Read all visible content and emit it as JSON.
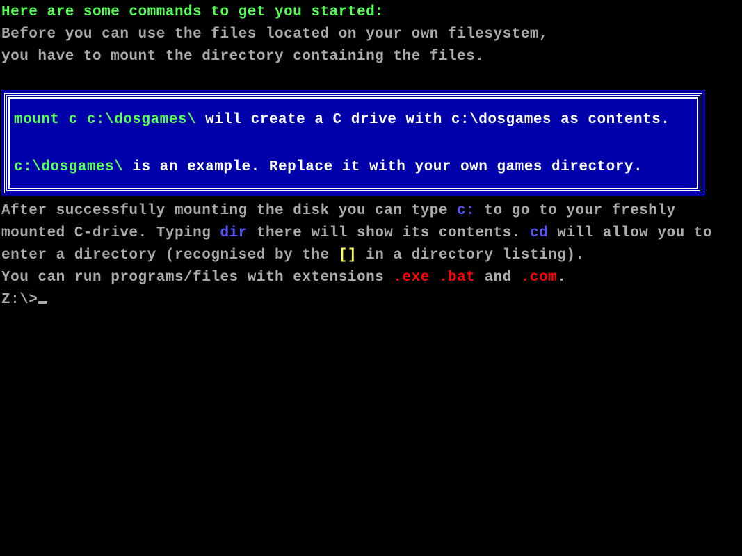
{
  "intro": {
    "heading": "Here are some commands to get you started:",
    "line1": "Before you can use the files located on your own filesystem,",
    "line2": "you have to mount the directory containing the files."
  },
  "box": {
    "cmd1": "mount c c:\\dosgames\\",
    "cmd1_rest": " will create a C drive with c:\\dosgames as contents.",
    "cmd2": "c:\\dosgames\\",
    "cmd2_rest": " is an example. Replace it with your own games directory."
  },
  "after": {
    "seg1a": "After successfully mounting the disk you can type ",
    "c_colon": "c:",
    "seg1b": " to go to your freshly",
    "seg2a": "mounted C-drive. Typing ",
    "dir": "dir",
    "seg2b": " there will show its contents. ",
    "cd": "cd",
    "seg2c": " will allow you to",
    "seg3a": "enter a directory (recognised by the ",
    "brackets": "[]",
    "seg3b": " in a directory listing).",
    "seg4a": "You can run programs/files with extensions ",
    "exe": ".exe",
    "sp1": " ",
    "bat": ".bat",
    "and": " and ",
    "com": ".com",
    "period": "."
  },
  "prompt": {
    "text": "Z:\\>"
  }
}
